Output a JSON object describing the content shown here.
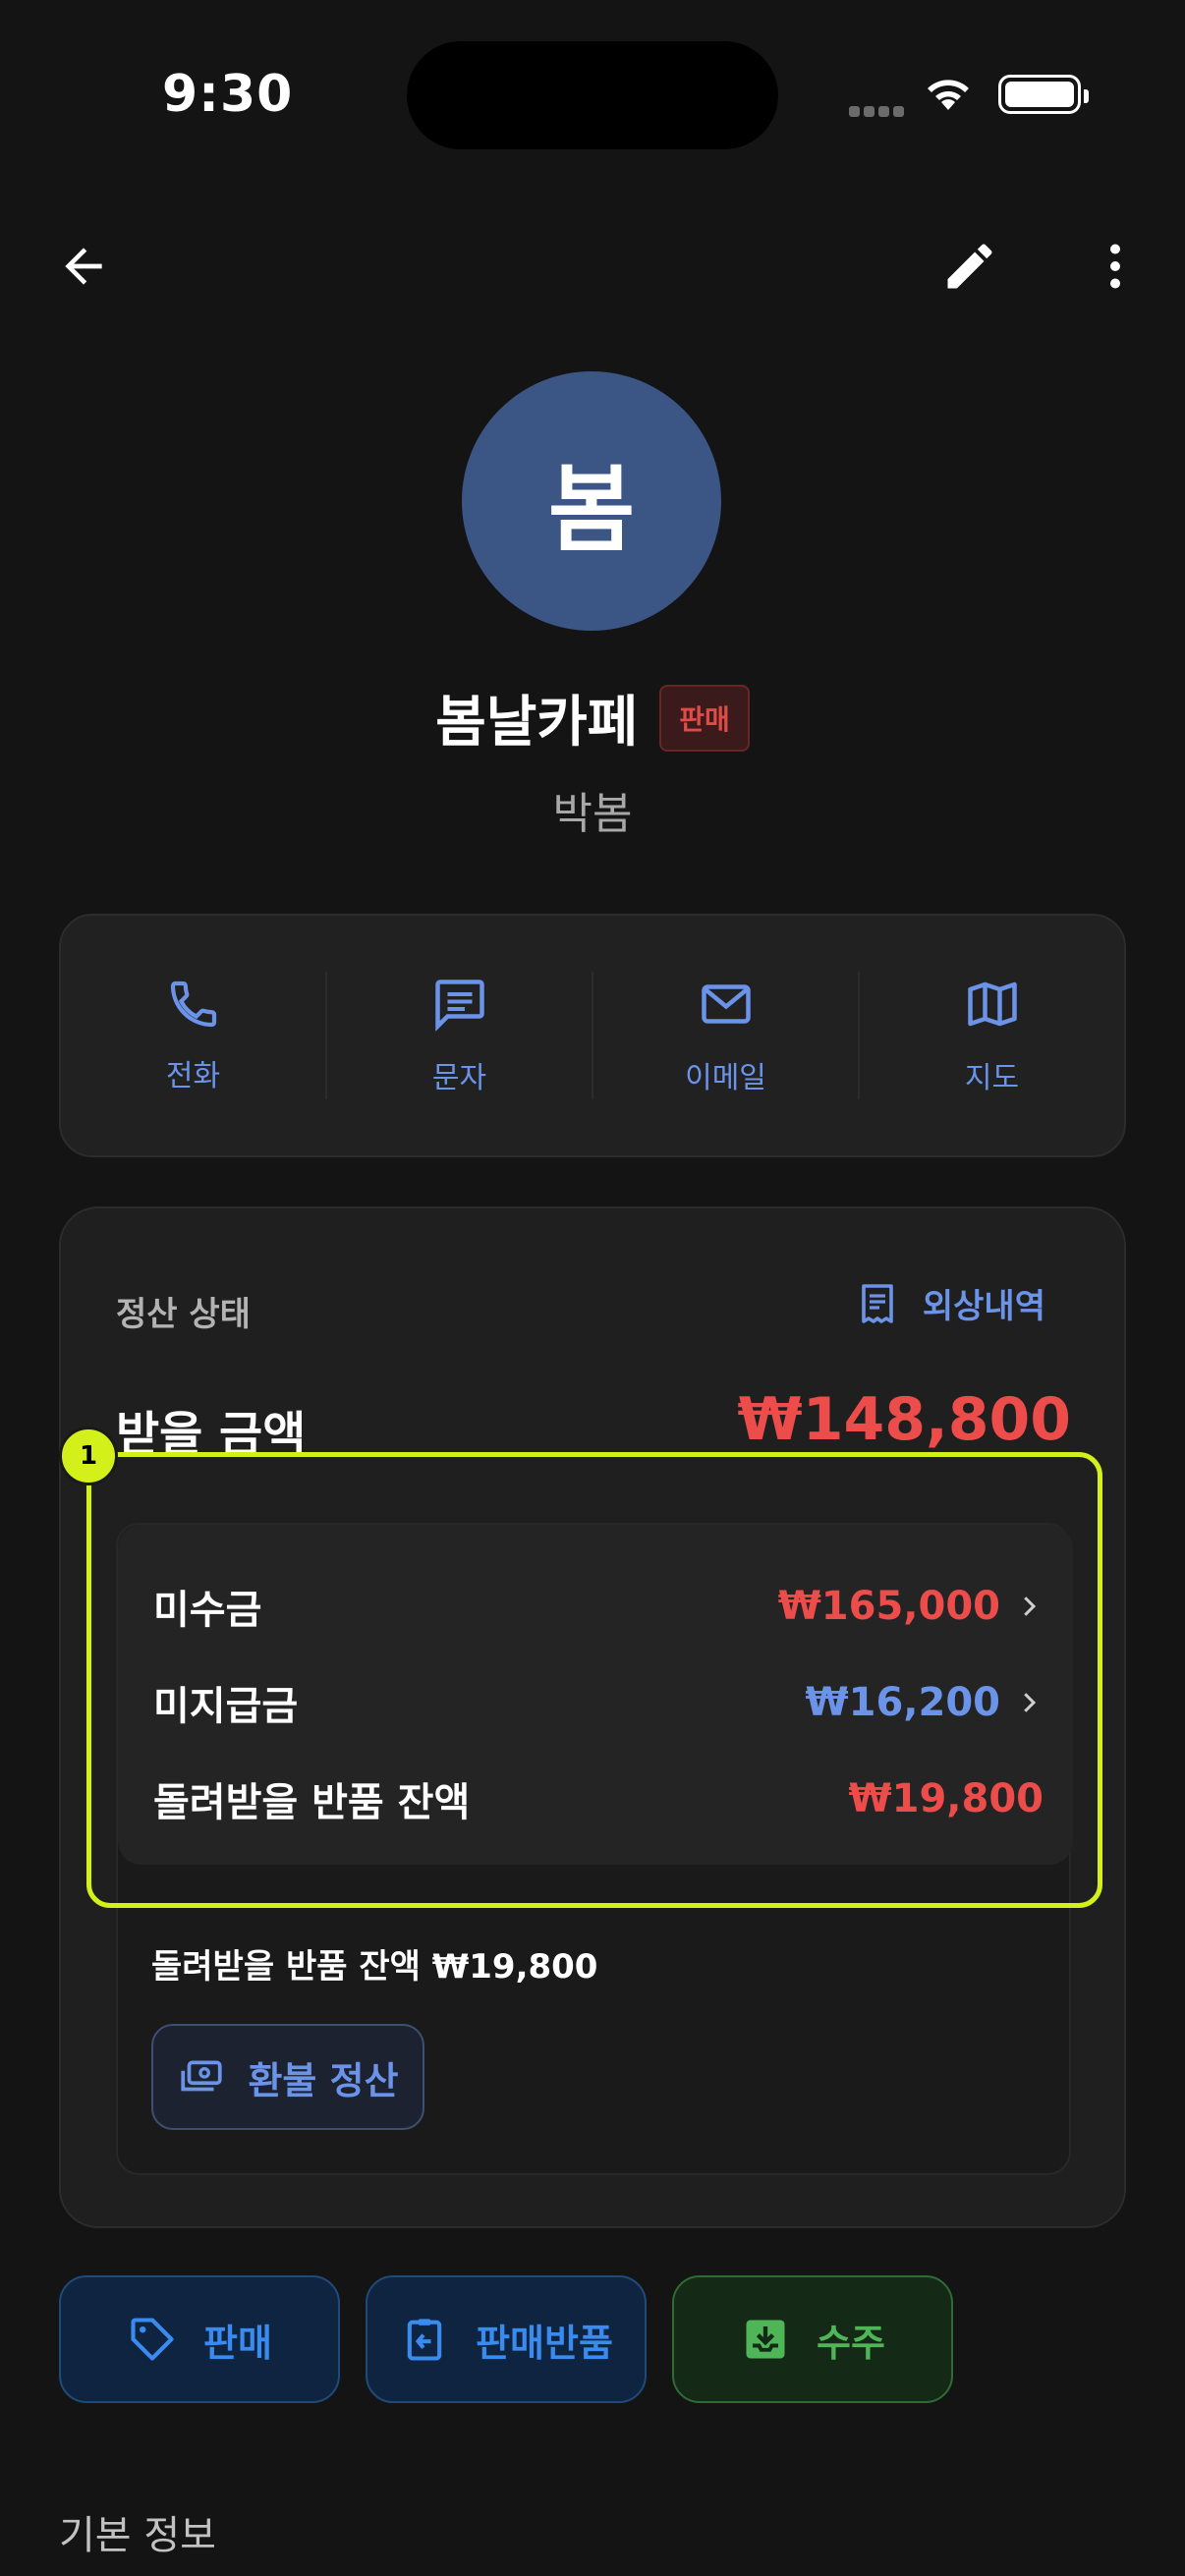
{
  "status_bar": {
    "time": "9:30"
  },
  "profile": {
    "avatar_initial": "봄",
    "name": "봄날카페",
    "type_badge": "판매",
    "contact_person": "박봄"
  },
  "actions": [
    {
      "label": "전화",
      "icon": "phone-icon"
    },
    {
      "label": "문자",
      "icon": "message-icon"
    },
    {
      "label": "이메일",
      "icon": "mail-icon"
    },
    {
      "label": "지도",
      "icon": "map-icon"
    }
  ],
  "settlement": {
    "heading": "정산 상태",
    "ledger_link": "외상내역",
    "receivable_label": "받을 금액",
    "receivable_amount": "₩148,800",
    "rows": [
      {
        "label": "미수금",
        "value": "₩165,000"
      },
      {
        "label": "미지급금",
        "value": "₩16,200"
      },
      {
        "label": "돌려받을 반품 잔액",
        "value": "₩19,800"
      }
    ],
    "return_balance_text": "돌려받을 반품 잔액 ₩19,800",
    "refund_button": "환불 정산"
  },
  "annotation_marker": "1",
  "bottom_actions": [
    {
      "label": "판매",
      "icon": "tag-icon"
    },
    {
      "label": "판매반품",
      "icon": "return-icon"
    },
    {
      "label": "수주",
      "icon": "inbox-download-icon"
    }
  ],
  "section_title": "기본 정보",
  "colors": {
    "background": "#141414",
    "accent_blue": "#6b93e8",
    "amount_red": "#ec4c4a",
    "highlight": "#d4f01a",
    "avatar": "#3b5585"
  }
}
